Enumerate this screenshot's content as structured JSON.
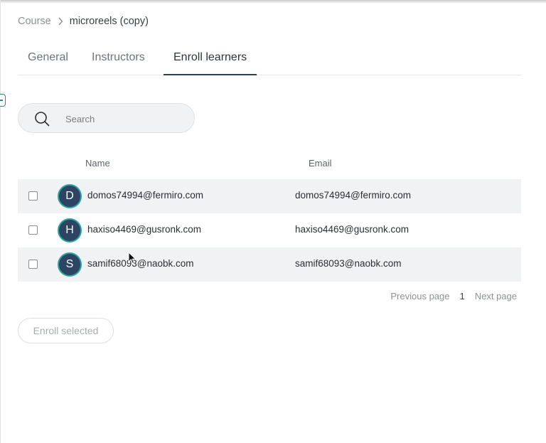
{
  "breadcrumb": {
    "root": "Course",
    "current": "microreels (copy)"
  },
  "tabs": [
    {
      "label": "General",
      "active": false
    },
    {
      "label": "Instructors",
      "active": false
    },
    {
      "label": "Enroll learners",
      "active": true
    }
  ],
  "search": {
    "placeholder": "Search",
    "value": ""
  },
  "table": {
    "columns": [
      "Name",
      "Email"
    ],
    "rows": [
      {
        "initial": "D",
        "name": "domos74994@fermiro.com",
        "email": "domos74994@fermiro.com",
        "checked": false
      },
      {
        "initial": "H",
        "name": "haxiso4469@gusronk.com",
        "email": "haxiso4469@gusronk.com",
        "checked": false
      },
      {
        "initial": "S",
        "name": "samif68093@naobk.com",
        "email": "samif68093@naobk.com",
        "checked": false
      }
    ]
  },
  "pagination": {
    "previous_label": "Previous page",
    "current_page": "1",
    "next_label": "Next page"
  },
  "actions": {
    "enroll_label": "Enroll selected"
  },
  "colors": {
    "accent": "#2d3f55",
    "avatar_bg": "#2e4463",
    "avatar_ring": "#2aa6a0",
    "row_stripe": "#f1f2f3"
  },
  "icons": {
    "search": "search-icon",
    "breadcrumb_separator": "chevron-right-icon",
    "side_toggle": "collapse-tab-icon"
  }
}
